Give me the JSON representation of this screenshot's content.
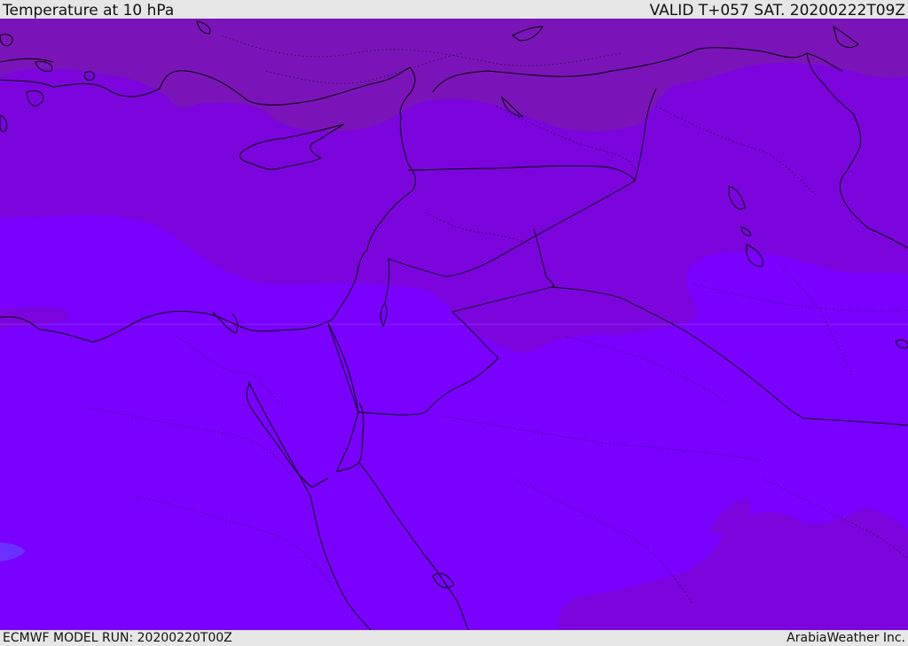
{
  "header": {
    "title": "Temperature at 10 hPa",
    "valid": "VALID T+057 SAT. 20200222T09Z"
  },
  "footer": {
    "model_run": "ECMWF MODEL RUN: 20200220T00Z",
    "credit": "ArabiaWeather Inc."
  },
  "map": {
    "colors": {
      "cold_band": "#7a14b8",
      "mid_band": "#7b05dc",
      "warm_band": "#7a00ff",
      "cool_patch": "#6a30ff",
      "coast_line": "#000000"
    }
  }
}
